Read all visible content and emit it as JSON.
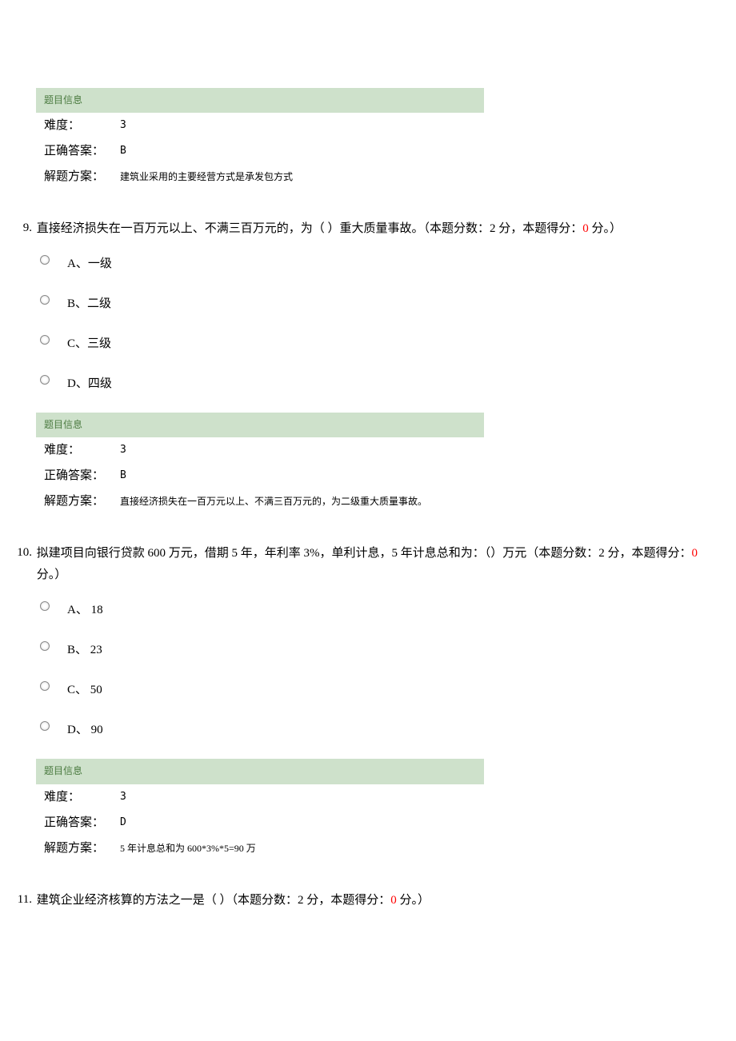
{
  "info_header_label": "题目信息",
  "labels": {
    "difficulty": "难度：",
    "answer": "正确答案：",
    "solution": "解题方案："
  },
  "q8_info": {
    "difficulty": "3",
    "answer": "B",
    "solution": "建筑业采用的主要经营方式是承发包方式"
  },
  "q9": {
    "num": "9.",
    "text_parts": {
      "p1": "直接经济损失在一百万元以上、不满三百万元的，为（ ）重大质量事故。（本题分数：2 分，本题得分：",
      "score_zero": "0",
      "p2": " 分。）"
    },
    "options": {
      "a": "A、一级",
      "b": "B、二级",
      "c": "C、三级",
      "d": "D、四级"
    },
    "info": {
      "difficulty": "3",
      "answer": "B",
      "solution": "直接经济损失在一百万元以上、不满三百万元的，为二级重大质量事故。"
    }
  },
  "q10": {
    "num": "10.",
    "text_parts": {
      "p1": "拟建项目向银行贷款 600 万元，借期 5 年，年利率 3%，单利计息，5 年计息总和为：（）万元（本题分数：2 分，本题得分：",
      "score_zero": "0",
      "p2": " 分。）"
    },
    "options": {
      "a": "A、 18",
      "b": "B、 23",
      "c": "C、 50",
      "d": "D、 90"
    },
    "info": {
      "difficulty": "3",
      "answer": "D",
      "solution": "5 年计息总和为 600*3%*5=90 万"
    }
  },
  "q11": {
    "num": "11.",
    "text_parts": {
      "p1": "建筑企业经济核算的方法之一是（ ）（本题分数：2 分，本题得分：",
      "score_zero": "0",
      "p2": " 分。）"
    }
  }
}
